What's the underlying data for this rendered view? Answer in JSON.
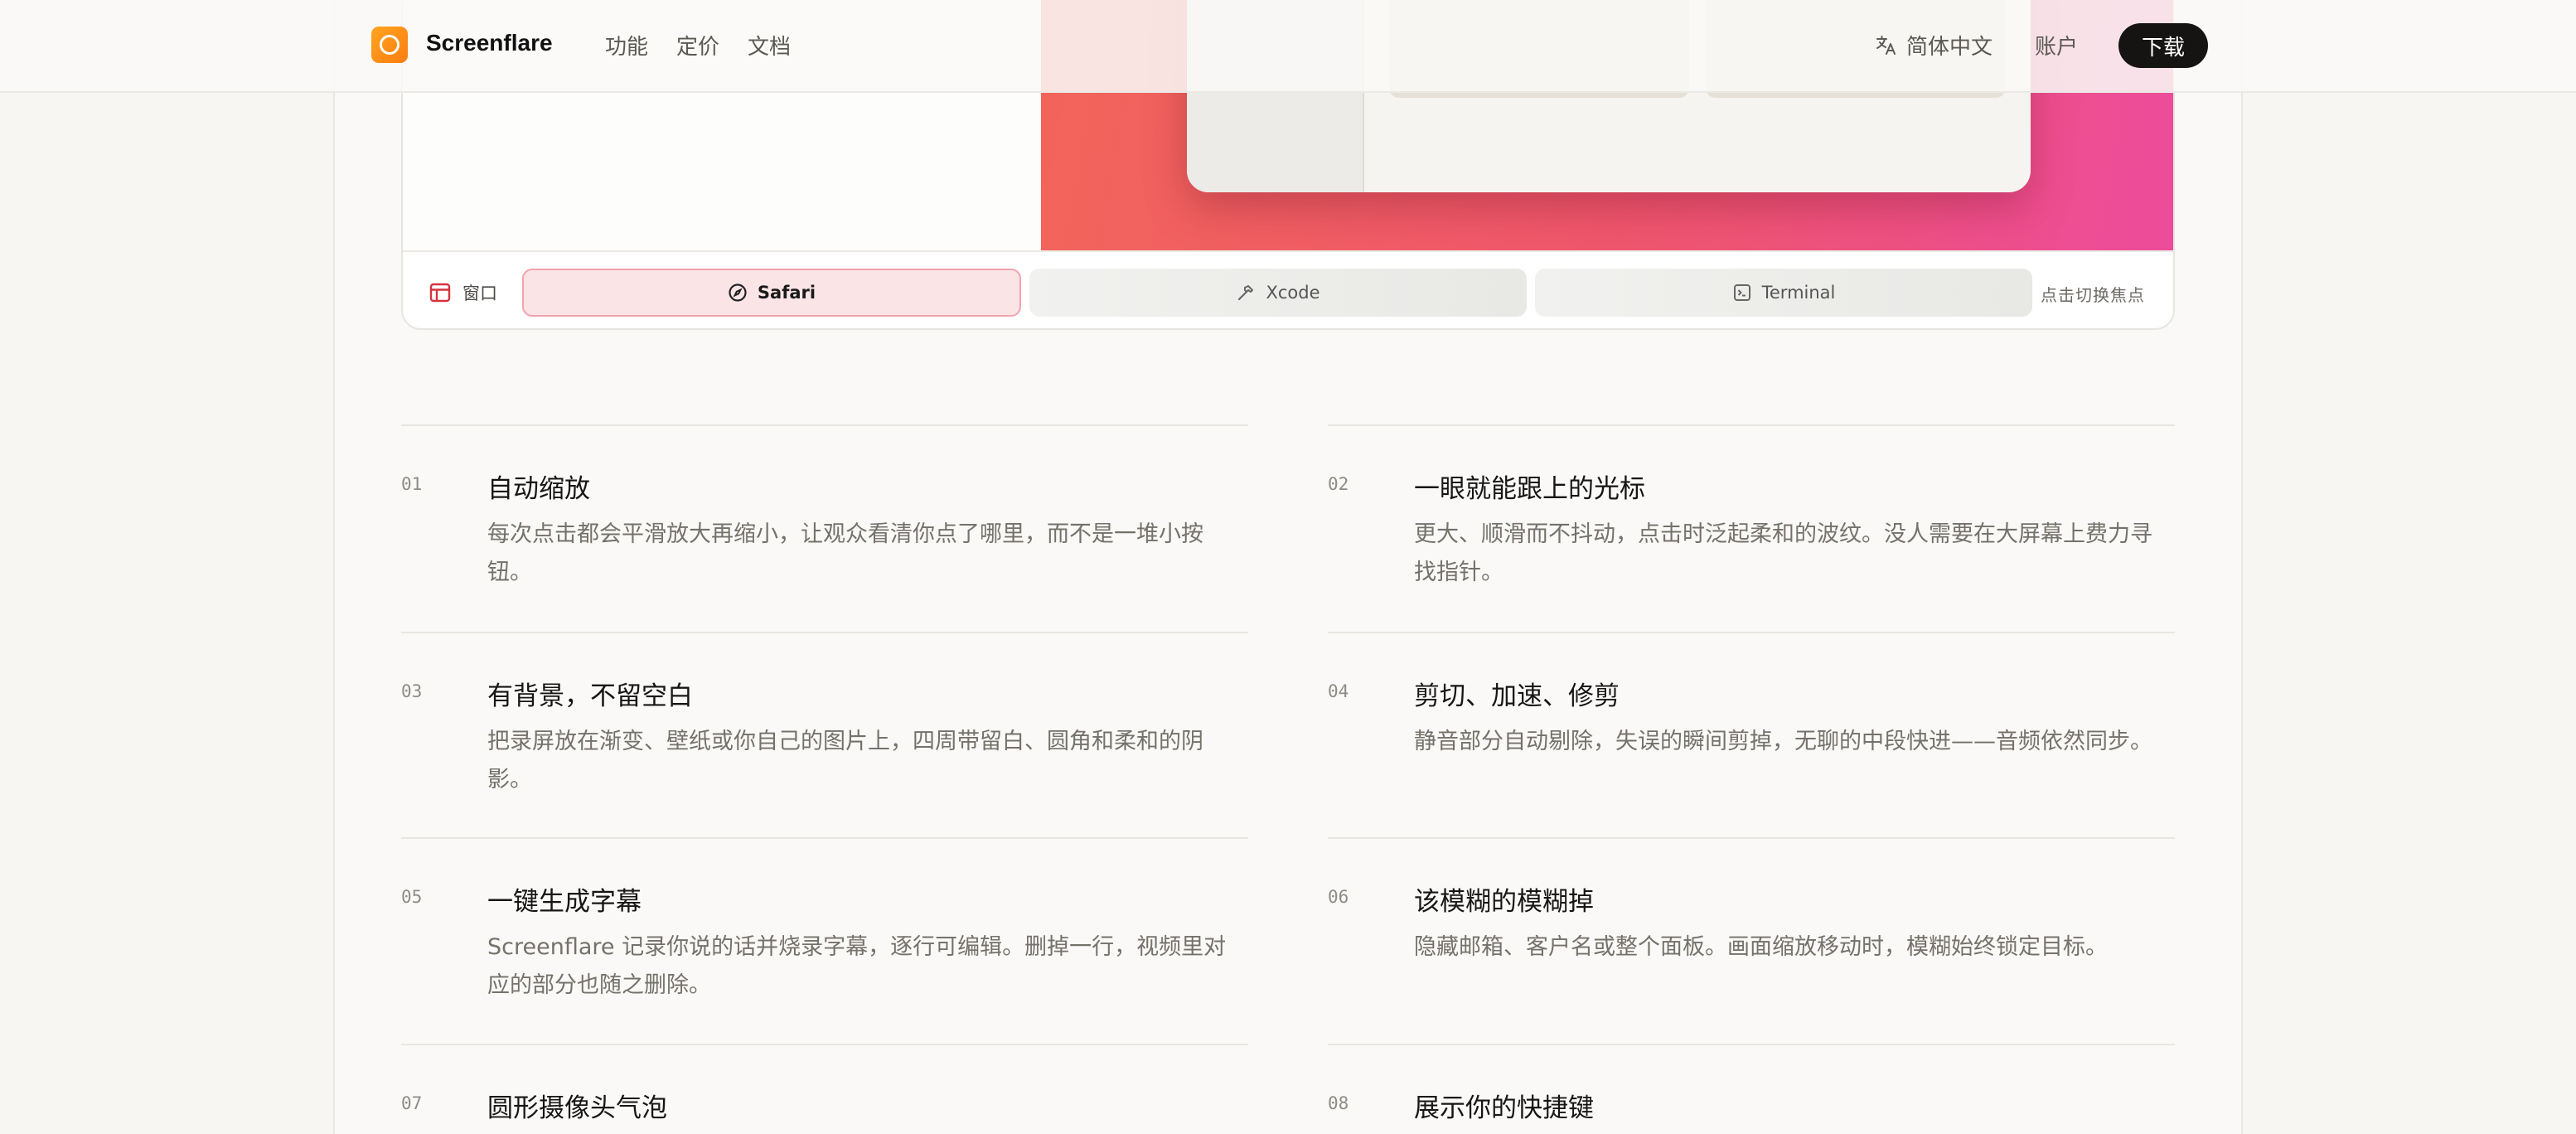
{
  "nav": {
    "brand": "Screenflare",
    "links": [
      "功能",
      "定价",
      "文档"
    ],
    "language": "简体中文",
    "account": "账户",
    "download": "下载"
  },
  "switcher": {
    "label": "窗口",
    "tabs": [
      {
        "label": "Safari",
        "icon": "compass-icon",
        "active": true
      },
      {
        "label": "Xcode",
        "icon": "hammer-icon",
        "active": false
      },
      {
        "label": "Terminal",
        "icon": "terminal-icon",
        "active": false
      }
    ],
    "hint": "点击切换焦点"
  },
  "features": [
    {
      "num": "01",
      "title": "自动缩放",
      "desc": "每次点击都会平滑放大再缩小，让观众看清你点了哪里，而不是一堆小按钮。"
    },
    {
      "num": "02",
      "title": "一眼就能跟上的光标",
      "desc": "更大、顺滑而不抖动，点击时泛起柔和的波纹。没人需要在大屏幕上费力寻找指针。"
    },
    {
      "num": "03",
      "title": "有背景，不留空白",
      "desc": "把录屏放在渐变、壁纸或你自己的图片上，四周带留白、圆角和柔和的阴影。"
    },
    {
      "num": "04",
      "title": "剪切、加速、修剪",
      "desc": "静音部分自动剔除，失误的瞬间剪掉，无聊的中段快进——音频依然同步。"
    },
    {
      "num": "05",
      "title": "一键生成字幕",
      "desc": "Screenflare 记录你说的话并烧录字幕，逐行可编辑。删掉一行，视频里对应的部分也随之删除。"
    },
    {
      "num": "06",
      "title": "该模糊的模糊掉",
      "desc": "隐藏邮箱、客户名或整个面板。画面缩放移动时，模糊始终锁定目标。"
    },
    {
      "num": "07",
      "title": "圆形摄像头气泡",
      "desc": ""
    },
    {
      "num": "08",
      "title": "展示你的快捷键",
      "desc": ""
    }
  ],
  "colors": {
    "accent": "#fb7d11",
    "active_tab_bg": "#fbe4e6",
    "hero_gradient_start": "#f2655a",
    "hero_gradient_end": "#ed4c9b"
  }
}
